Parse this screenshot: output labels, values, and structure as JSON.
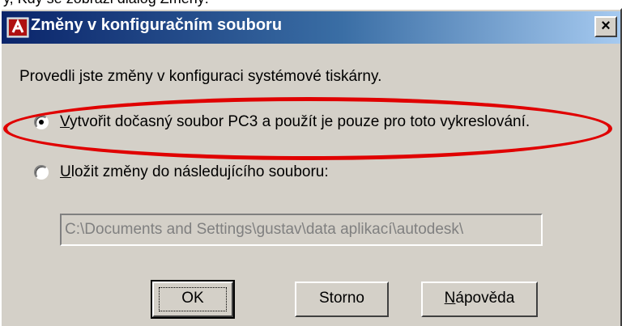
{
  "page_top_text": "y, Kdy se zobrazi dialog Změny:",
  "dialog": {
    "title": "Změny v konfiguračním souboru",
    "close_label": "×",
    "icon": "autocad-app-icon"
  },
  "message": "Provedli jste změny v konfiguraci systémové tiskárny.",
  "options": [
    {
      "mnemonic": "V",
      "rest": "ytvořit dočasný soubor PC3 a použít je pouze pro toto vykreslování.",
      "checked": true,
      "highlighted": true
    },
    {
      "mnemonic": "U",
      "rest": "ložit změny do následujícího souboru:",
      "checked": false,
      "highlighted": false
    }
  ],
  "path_field": {
    "value": "C:\\Documents and Settings\\gustav\\data aplikací\\autodesk\\",
    "disabled": true
  },
  "buttons": {
    "ok": "OK",
    "cancel": "Storno",
    "help_mnemonic": "N",
    "help_rest": "ápověda"
  },
  "colors": {
    "highlight": "#e00000",
    "titlebar_start": "#0a246a",
    "titlebar_end": "#a6caf0",
    "dialog_face": "#d4d0c8"
  }
}
